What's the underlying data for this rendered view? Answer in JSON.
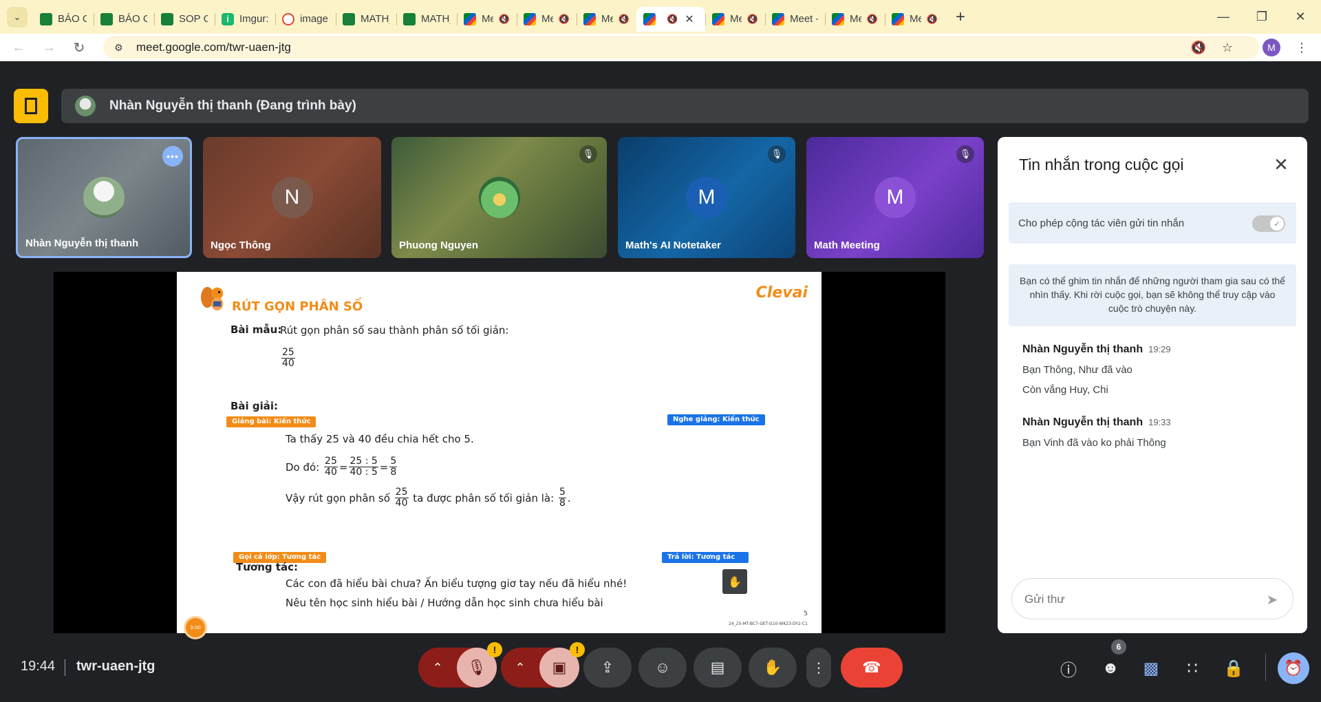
{
  "browser": {
    "tabs": [
      {
        "label": "BÁO C/",
        "icon": "sheets-icon",
        "kind": "sheet",
        "muted": false,
        "active": false
      },
      {
        "label": "BÁO C/",
        "icon": "sheets-icon",
        "kind": "sheet",
        "muted": false,
        "active": false
      },
      {
        "label": "SOP Or",
        "icon": "sheets-icon",
        "kind": "sheet",
        "muted": false,
        "active": false
      },
      {
        "label": "Imgur:",
        "icon": "imgur-icon",
        "kind": "imgur",
        "muted": false,
        "active": false
      },
      {
        "label": "image",
        "icon": "image-search-icon",
        "kind": "image",
        "muted": false,
        "active": false
      },
      {
        "label": "MATH_",
        "icon": "sheets-icon",
        "kind": "sheet",
        "muted": false,
        "active": false
      },
      {
        "label": "MATH_",
        "icon": "sheets-icon",
        "kind": "sheet",
        "muted": false,
        "active": false
      },
      {
        "label": "Me",
        "icon": "meet-icon",
        "kind": "meet",
        "muted": true,
        "active": false
      },
      {
        "label": "Me",
        "icon": "meet-icon",
        "kind": "meet",
        "muted": true,
        "active": false
      },
      {
        "label": "Me",
        "icon": "meet-icon",
        "kind": "meet",
        "muted": true,
        "active": false
      },
      {
        "label": "",
        "icon": "meet-icon",
        "kind": "meet",
        "muted": true,
        "active": true
      },
      {
        "label": "Me",
        "icon": "meet-icon",
        "kind": "meet",
        "muted": true,
        "active": false
      },
      {
        "label": "Meet -",
        "icon": "meet-icon",
        "kind": "meet",
        "muted": false,
        "active": false
      },
      {
        "label": "Me",
        "icon": "meet-icon",
        "kind": "meet",
        "muted": true,
        "active": false
      },
      {
        "label": "Me",
        "icon": "meet-icon",
        "kind": "meet",
        "muted": true,
        "active": false
      }
    ],
    "url": "meet.google.com/twr-uaen-jtg",
    "profile_initial": "M"
  },
  "meet": {
    "presenter_label": "Nhàn Nguyễn thị thanh (Đang trình bày)",
    "participants": [
      {
        "name": "Nhàn Nguyễn thị thanh",
        "initial": ""
      },
      {
        "name": "Ngọc Thông",
        "initial": "N"
      },
      {
        "name": "Phuong Nguyen",
        "initial": ""
      },
      {
        "name": "Math's AI Notetaker",
        "initial": "M"
      },
      {
        "name": "Math Meeting",
        "initial": "M"
      }
    ],
    "slide": {
      "title": "RÚT GỌN PHÂN SỐ",
      "logo": "Clevai",
      "sample_label": "Bài mẫu:",
      "sample_text": "Rút gọn phân số sau thành phân số tối giản:",
      "frac_num": "25",
      "frac_den": "40",
      "solution_label": "Bài giải:",
      "tag_teach": "Giảng bài: Kiến thức",
      "tag_listen": "Nghe giảng: Kiến thức",
      "line1": "Ta thấy 25 và 40 đều chia hết cho 5.",
      "line2_prefix": "Do đó:",
      "line2_mid_num": "25 : 5",
      "line2_mid_den": "40 : 5",
      "line2_res_num": "5",
      "line2_res_den": "8",
      "line3_prefix": "Vậy rút gọn phân số",
      "line3_mid": "ta được phân số tối giản là:",
      "tag_callclass": "Gọi cả lớp: Tương tác",
      "tag_answer": "Trả lời: Tương tác",
      "interact_label": "Tương tác:",
      "q1": "Các con đã hiểu bài chưa? Ấn biểu tượng giơ tay nếu đã hiểu nhé!",
      "q2": "Nêu tên học sinh hiểu bài / Hướng dẫn học sinh chưa hiểu bài",
      "timer": "3:00",
      "page": "5",
      "code": "24_25-MT-BC7-GET-G10-WK23-DY2-C1"
    }
  },
  "chat": {
    "title": "Tin nhắn trong cuộc gọi",
    "toggle_label": "Cho phép cộng tác viên gửi tin nhắn",
    "toggle_on": true,
    "info": "Bạn có thể ghim tin nhắn để những người tham gia sau có thể nhìn thấy. Khi rời cuộc gọi, bạn sẽ không thể truy cập vào cuộc trò chuyện này.",
    "messages": [
      {
        "author": "Nhàn Nguyễn thị thanh",
        "time": "19:29",
        "lines": [
          "Bạn Thông, Như đã vào",
          "Còn vắng Huy, Chi"
        ]
      },
      {
        "author": "Nhàn Nguyễn thị thanh",
        "time": "19:33",
        "lines": [
          "Bạn Vinh đã vào ko phải Thông"
        ]
      }
    ],
    "compose_placeholder": "Gửi thư"
  },
  "bottom": {
    "time": "19:44",
    "meeting_code": "twr-uaen-jtg",
    "people_count": "6",
    "warn_mark": "!"
  },
  "colors": {
    "accent": "#8ab4f8",
    "hangup": "#ea4335",
    "present_yellow": "#fbbc04",
    "slide_orange": "#f28c18"
  }
}
